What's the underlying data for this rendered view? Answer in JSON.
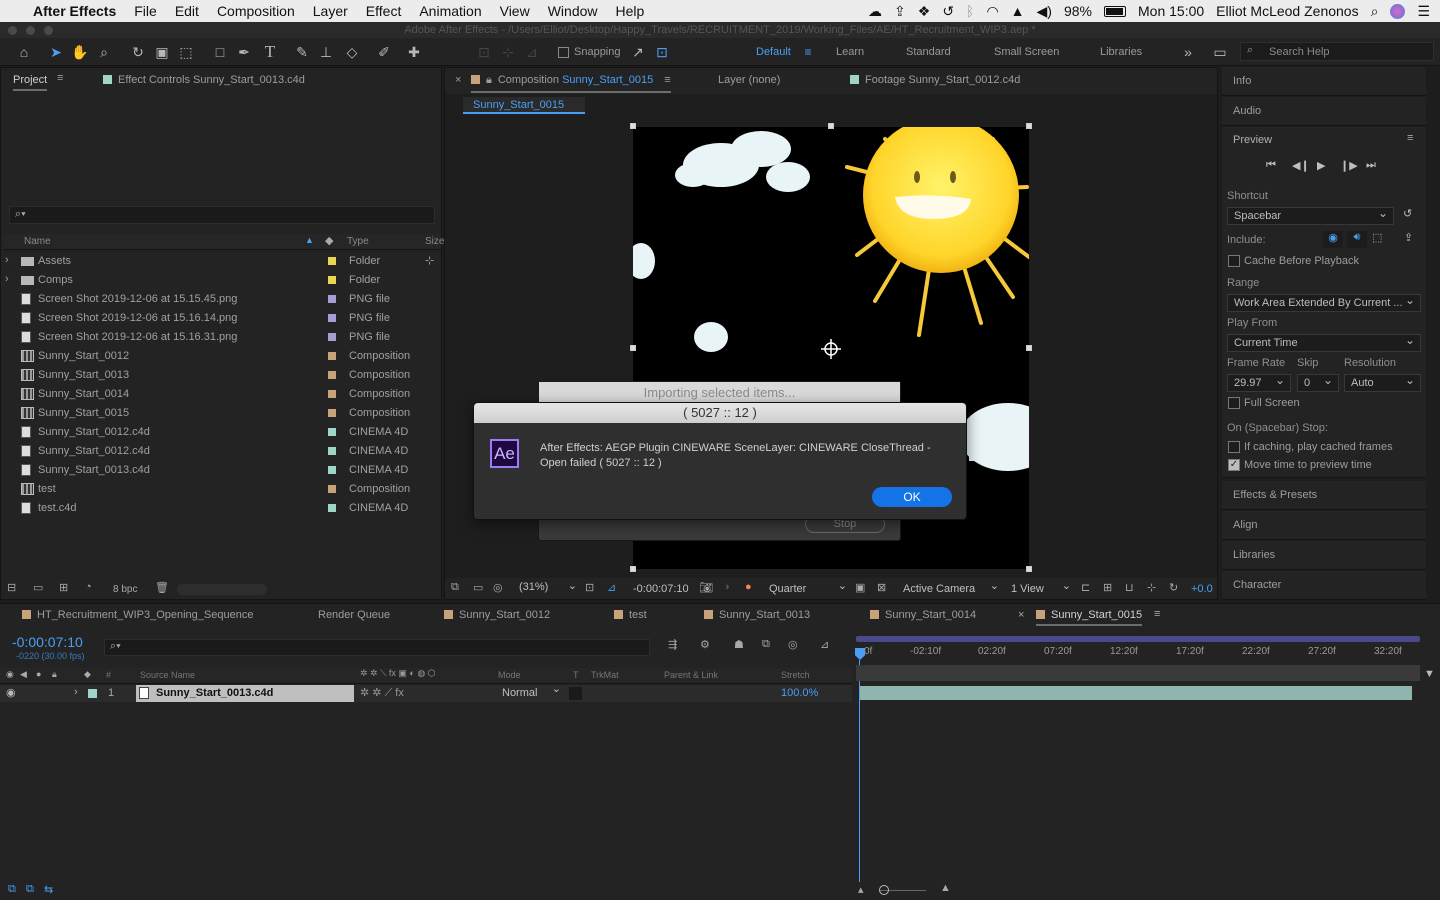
{
  "menubar": {
    "apple": "",
    "app": "After Effects",
    "items": [
      "File",
      "Edit",
      "Composition",
      "Layer",
      "Effect",
      "Animation",
      "View",
      "Window",
      "Help"
    ],
    "battery": "98%",
    "clock": "Mon 15:00",
    "user": "Elliot McLeod Zenonos"
  },
  "titlebar": {
    "text": "Adobe After Effects - /Users/Elliot/Desktop/Happy_Travels/RECRUITMENT_2019/Working_Files/AE/HT_Recruitment_WIP3.aep *"
  },
  "toolbar": {
    "snapping": "Snapping",
    "workspaces": [
      "Default",
      "Learn",
      "Standard",
      "Small Screen",
      "Libraries"
    ],
    "active_workspace": "Default",
    "search_placeholder": "Search Help"
  },
  "project": {
    "tab": "Project",
    "effect_controls": "Effect Controls Sunny_Start_0013.c4d",
    "col_name": "Name",
    "col_type": "Type",
    "col_size": "Size",
    "bpc": "8 bpc",
    "items": [
      {
        "name": "Assets",
        "type": "Folder",
        "color": "#e8d552",
        "icon": "folder"
      },
      {
        "name": "Comps",
        "type": "Folder",
        "color": "#e8d552",
        "icon": "folder"
      },
      {
        "name": "Screen Shot 2019-12-06 at 15.15.45.png",
        "type": "PNG file",
        "color": "#a79ed6",
        "icon": "file"
      },
      {
        "name": "Screen Shot 2019-12-06 at 15.16.14.png",
        "type": "PNG file",
        "color": "#a79ed6",
        "icon": "file"
      },
      {
        "name": "Screen Shot 2019-12-06 at 15.16.31.png",
        "type": "PNG file",
        "color": "#a79ed6",
        "icon": "file"
      },
      {
        "name": "Sunny_Start_0012",
        "type": "Composition",
        "color": "#c8a37a",
        "icon": "comp"
      },
      {
        "name": "Sunny_Start_0013",
        "type": "Composition",
        "color": "#c8a37a",
        "icon": "comp"
      },
      {
        "name": "Sunny_Start_0014",
        "type": "Composition",
        "color": "#c8a37a",
        "icon": "comp"
      },
      {
        "name": "Sunny_Start_0015",
        "type": "Composition",
        "color": "#c8a37a",
        "icon": "comp"
      },
      {
        "name": "Sunny_Start_0012.c4d",
        "type": "CINEMA 4D",
        "color": "#9fd5c8",
        "icon": "c4d"
      },
      {
        "name": "Sunny_Start_0012.c4d",
        "type": "CINEMA 4D",
        "color": "#9fd5c8",
        "icon": "c4d"
      },
      {
        "name": "Sunny_Start_0013.c4d",
        "type": "CINEMA 4D",
        "color": "#9fd5c8",
        "icon": "c4d"
      },
      {
        "name": "test",
        "type": "Composition",
        "color": "#c8a37a",
        "icon": "comp"
      },
      {
        "name": "test.c4d",
        "type": "CINEMA 4D",
        "color": "#9fd5c8",
        "icon": "c4d"
      }
    ]
  },
  "viewer": {
    "comp_tab_prefix": "Composition",
    "comp_tab_name": "Sunny_Start_0015",
    "layer_tab": "Layer (none)",
    "footage_tab": "Footage Sunny_Start_0012.c4d",
    "breadcrumb": "Sunny_Start_0015",
    "zoom": "(31%)",
    "timecode": "-0:00:07:10",
    "resolution": "Quarter",
    "camera": "Active Camera",
    "views": "1 View",
    "exposure": "+0.0"
  },
  "import_dialog": {
    "text": "Importing selected items...",
    "stop": "Stop"
  },
  "error_dialog": {
    "title": "( 5027 :: 12 )",
    "icon": "Ae",
    "message": "After Effects: AEGP Plugin CINEWARE SceneLayer: CINEWARE CloseThread - Open failed ( 5027 :: 12 )",
    "ok": "OK"
  },
  "right_panel": {
    "info": "Info",
    "audio": "Audio",
    "preview": "Preview",
    "shortcut_label": "Shortcut",
    "shortcut": "Spacebar",
    "include_label": "Include:",
    "cache_before": "Cache Before Playback",
    "range_label": "Range",
    "range": "Work Area Extended By Current ...",
    "play_from_label": "Play From",
    "play_from": "Current Time",
    "frame_rate_label": "Frame Rate",
    "skip_label": "Skip",
    "resolution_label": "Resolution",
    "frame_rate": "29.97",
    "skip": "0",
    "resolution": "Auto",
    "full_screen": "Full Screen",
    "stop_label": "On (Spacebar) Stop:",
    "if_caching": "If caching, play cached frames",
    "move_time": "Move time to preview time",
    "effects": "Effects & Presets",
    "align": "Align",
    "libraries": "Libraries",
    "character": "Character"
  },
  "timeline": {
    "tabs": [
      "HT_Recruitment_WIP3_Opening_Sequence",
      "Render Queue",
      "Sunny_Start_0012",
      "test",
      "Sunny_Start_0013",
      "Sunny_Start_0014",
      "Sunny_Start_0015"
    ],
    "timecode": "-0:00:07:10",
    "frames": "-0220 (30.00 fps)",
    "col_source": "Source Name",
    "col_mode": "Mode",
    "col_t": "T",
    "col_trkmat": "TrkMat",
    "col_parent": "Parent & Link",
    "col_stretch": "Stretch",
    "layer_num": "1",
    "layer_name": "Sunny_Start_0013.c4d",
    "layer_mode": "Normal",
    "layer_stretch": "100.0%",
    "ruler": [
      "0f",
      "-02:10f",
      "02:20f",
      "07:20f",
      "12:20f",
      "17:20f",
      "22:20f",
      "27:20f",
      "32:20f"
    ]
  }
}
